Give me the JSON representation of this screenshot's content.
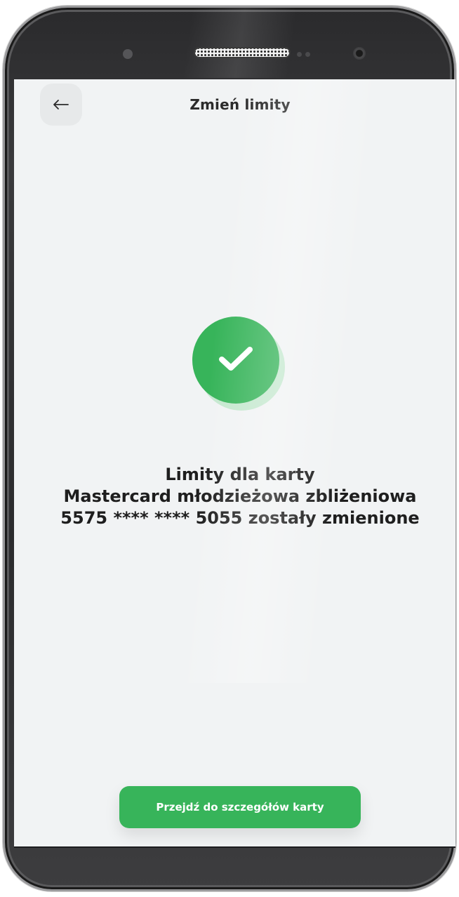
{
  "header": {
    "title": "Zmień limity",
    "back_icon": "arrow-left-icon"
  },
  "status": {
    "icon": "checkmark-icon",
    "color": "#37b45a"
  },
  "message": {
    "line1": "Limity dla karty",
    "line2": "Mastercard młodzieżowa zbliżeniowa",
    "line3": "5575 **** **** 5055 zostały zmienione"
  },
  "actions": {
    "details_button": "Przejdź do szczegółów karty"
  },
  "colors": {
    "accent": "#37b45a",
    "background": "#f1f3f4",
    "text": "#1e1e1e"
  }
}
